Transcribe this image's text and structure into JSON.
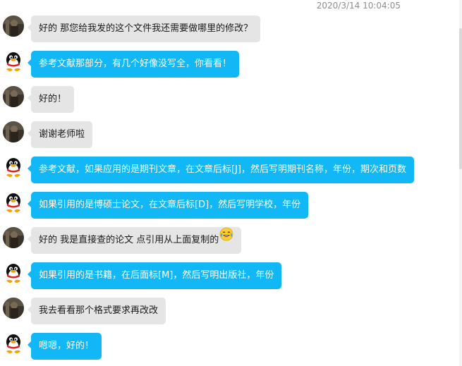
{
  "timestamp": "2020/3/14 10:04:05",
  "messages": [
    {
      "sender": "user",
      "avatar": "user-avatar",
      "text": "好的 那您给我发的这个文件我还需要做哪里的修改？"
    },
    {
      "sender": "qq",
      "avatar": "qq-penguin-avatar",
      "text": "参考文献那部分，有几个好像没写全，你看看！"
    },
    {
      "sender": "user",
      "avatar": "user-avatar",
      "text": "好的！"
    },
    {
      "sender": "user",
      "avatar": "user-avatar",
      "text": "谢谢老师啦"
    },
    {
      "sender": "qq",
      "avatar": "qq-penguin-avatar",
      "text": "参考文献，如果应用的是期刊文章，在文章后标[J]，然后写明期刊名称，年份，期次和页数"
    },
    {
      "sender": "qq",
      "avatar": "qq-penguin-avatar",
      "text": "如果引用的是博硕士论文，在文章后标[D]，然后写明学校，年份"
    },
    {
      "sender": "user",
      "avatar": "user-avatar",
      "text": "好的 我是直接查的论文 点引用从上面复制的",
      "emoji": "laughing-tears-emoji"
    },
    {
      "sender": "qq",
      "avatar": "qq-penguin-avatar",
      "text": "如果引用的是书籍，在后面标[M]，然后写明出版社，年份"
    },
    {
      "sender": "user",
      "avatar": "user-avatar",
      "text": "我去看看那个格式要求再改改"
    },
    {
      "sender": "qq",
      "avatar": "qq-penguin-avatar",
      "text": "嗯嗯，好的！"
    }
  ],
  "colors": {
    "qq_bubble": "#12b7f5",
    "user_bubble": "#e5e5e5",
    "timestamp": "#8c8c8c"
  }
}
